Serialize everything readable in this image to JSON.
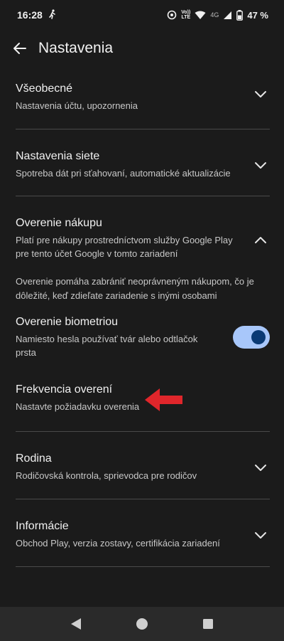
{
  "status_bar": {
    "time": "16:28",
    "volte": "Vo))\nLTE",
    "network": "4G",
    "battery": "47 %"
  },
  "app_bar": {
    "title": "Nastavenia"
  },
  "sections": {
    "general": {
      "title": "Všeobecné",
      "subtitle": "Nastavenia účtu, upozornenia"
    },
    "network": {
      "title": "Nastavenia siete",
      "subtitle": "Spotreba dát pri sťahovaní, automatické aktualizácie"
    },
    "purchase_auth": {
      "title": "Overenie nákupu",
      "subtitle": "Platí pre nákupy prostredníctvom služby Google Play pre tento účet Google v tomto zariadení",
      "description": "Overenie pomáha zabrániť neoprávneným nákupom, čo je dôležité, keď zdieľate zariadenie s inými osobami",
      "biometric": {
        "title": "Overenie biometriou",
        "subtitle": "Namiesto hesla používať tvár alebo odtlačok prsta",
        "enabled": true
      },
      "frequency": {
        "title": "Frekvencia overení",
        "subtitle": "Nastavte požiadavku overenia"
      }
    },
    "family": {
      "title": "Rodina",
      "subtitle": "Rodičovská kontrola, sprievodca pre rodičov"
    },
    "about": {
      "title": "Informácie",
      "subtitle": "Obchod Play, verzia zostavy, certifikácia zariadení"
    }
  },
  "icons": {
    "back": "arrow-left-icon",
    "expand": "chevron-down-icon",
    "collapse": "chevron-up-icon"
  },
  "colors": {
    "background": "#1b1b1b",
    "toggle_track": "#a8c7fa",
    "toggle_knob": "#0a3a74",
    "annotation_arrow": "#e0262b"
  }
}
